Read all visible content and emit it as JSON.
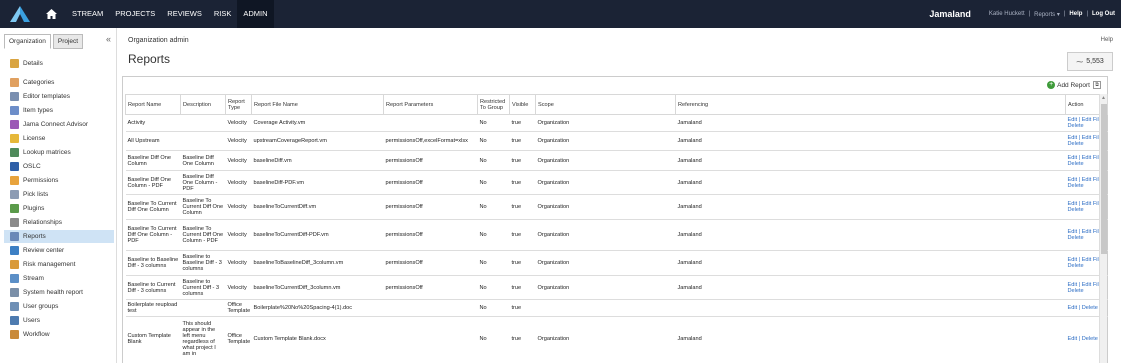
{
  "topnav": {
    "items": [
      "STREAM",
      "PROJECTS",
      "REVIEWS",
      "RISK",
      "ADMIN"
    ],
    "active": "ADMIN",
    "project": "Jamaland",
    "user": "Katie Huckett",
    "reports": "Reports ▾",
    "help": "Help",
    "logout": "Log Out",
    "separator": "|"
  },
  "sidebar": {
    "tabs": [
      "Organization",
      "Project"
    ],
    "collapse": "«",
    "items": [
      {
        "label": "Details",
        "icon": "details-icon",
        "color": "#d9a441"
      },
      {
        "label": "Categories",
        "icon": "categories-icon",
        "color": "#e0a060"
      },
      {
        "label": "Editor templates",
        "icon": "editor-templates-icon",
        "color": "#7a8fb0"
      },
      {
        "label": "Item types",
        "icon": "item-types-icon",
        "color": "#6d8ec9"
      },
      {
        "label": "Jama Connect Advisor",
        "icon": "advisor-icon",
        "color": "#9b59b6"
      },
      {
        "label": "License",
        "icon": "license-icon",
        "color": "#e6b83a"
      },
      {
        "label": "Lookup matrices",
        "icon": "lookup-matrices-icon",
        "color": "#4f8a5b"
      },
      {
        "label": "OSLC",
        "icon": "oslc-icon",
        "color": "#2e5fa8"
      },
      {
        "label": "Permissions",
        "icon": "permissions-icon",
        "color": "#e8a33c"
      },
      {
        "label": "Pick lists",
        "icon": "pick-lists-icon",
        "color": "#8c9bb3"
      },
      {
        "label": "Plugins",
        "icon": "plugins-icon",
        "color": "#5a9a4a"
      },
      {
        "label": "Relationships",
        "icon": "relationships-icon",
        "color": "#8a8a8a"
      },
      {
        "label": "Reports",
        "icon": "reports-icon",
        "color": "#6a88b8"
      },
      {
        "label": "Review center",
        "icon": "review-center-icon",
        "color": "#3c7fc4"
      },
      {
        "label": "Risk management",
        "icon": "risk-management-icon",
        "color": "#d99a3a"
      },
      {
        "label": "Stream",
        "icon": "stream-icon",
        "color": "#5b8fc7"
      },
      {
        "label": "System health report",
        "icon": "system-health-icon",
        "color": "#7a8fa8"
      },
      {
        "label": "User groups",
        "icon": "user-groups-icon",
        "color": "#6e8fb5"
      },
      {
        "label": "Users",
        "icon": "users-icon",
        "color": "#4d7bb0"
      },
      {
        "label": "Workflow",
        "icon": "workflow-icon",
        "color": "#c98a3a"
      }
    ],
    "active": "Reports"
  },
  "main": {
    "breadcrumb": "Organization admin",
    "help": "Help",
    "title": "Reports",
    "stat": "5,553",
    "add_report": "Add Report",
    "columns": [
      "Report Name",
      "Description",
      "Report Type",
      "Report File Name",
      "Report Parameters",
      "Restricted To Group",
      "Visible",
      "Scope",
      "Referencing",
      "Action"
    ],
    "rows": [
      {
        "name": "Activity",
        "desc": "",
        "type": "Velocity",
        "file": "Coverage Activity.vm",
        "params": "",
        "restricted": "No",
        "visible": "true",
        "scope": "Organization",
        "ref": "Jamaland",
        "action": "Edit | Edit File | Delete"
      },
      {
        "name": "All Upstream",
        "desc": "",
        "type": "Velocity",
        "file": "upstreamCoverageReport.vm",
        "params": "permissionsOff,excelFormat=xlsx",
        "restricted": "No",
        "visible": "true",
        "scope": "Organization",
        "ref": "Jamaland",
        "action": "Edit | Edit File | Delete"
      },
      {
        "name": "Baseline Diff One Column",
        "desc": "Baseline Diff One Column",
        "type": "Velocity",
        "file": "baselineDiff.vm",
        "params": "permissionsOff",
        "restricted": "No",
        "visible": "true",
        "scope": "Organization",
        "ref": "Jamaland",
        "action": "Edit | Edit File | Delete"
      },
      {
        "name": "Baseline Diff One Column - PDF",
        "desc": "Baseline Diff One Column - PDF",
        "type": "Velocity",
        "file": "baselineDiff-PDF.vm",
        "params": "permissionsOff",
        "restricted": "No",
        "visible": "true",
        "scope": "Organization",
        "ref": "Jamaland",
        "action": "Edit | Edit File | Delete"
      },
      {
        "name": "Baseline To Current Diff One Column",
        "desc": "Baseline To Current Diff One Column",
        "type": "Velocity",
        "file": "baselineToCurrentDiff.vm",
        "params": "permissionsOff",
        "restricted": "No",
        "visible": "true",
        "scope": "Organization",
        "ref": "Jamaland",
        "action": "Edit | Edit File | Delete"
      },
      {
        "name": "Baseline To Current Diff One Column - PDF",
        "desc": "Baseline To Current Diff One Column - PDF",
        "type": "Velocity",
        "file": "baselineToCurrentDiff-PDF.vm",
        "params": "permissionsOff",
        "restricted": "No",
        "visible": "true",
        "scope": "Organization",
        "ref": "Jamaland",
        "action": "Edit | Edit File | Delete"
      },
      {
        "name": "Baseline to Baseline Diff - 3 columns",
        "desc": "Baseline to Baseline Diff - 3 columns",
        "type": "Velocity",
        "file": "baselineToBaselineDiff_3column.vm",
        "params": "permissionsOff",
        "restricted": "No",
        "visible": "true",
        "scope": "Organization",
        "ref": "Jamaland",
        "action": "Edit | Edit File | Delete"
      },
      {
        "name": "Baseline to Current Diff - 3 columns",
        "desc": "Baseline to Current Diff - 3 columns",
        "type": "Velocity",
        "file": "baselineToCurrentDiff_3column.vm",
        "params": "permissionsOff",
        "restricted": "No",
        "visible": "true",
        "scope": "Organization",
        "ref": "Jamaland",
        "action": "Edit | Edit File | Delete"
      },
      {
        "name": "Boilerplate reupload test",
        "desc": "",
        "type": "Office Template",
        "file": "Boilerplate%20No%20Spacing-4(1).doc",
        "params": "",
        "restricted": "No",
        "visible": "true",
        "scope": "",
        "ref": "",
        "action": "Edit | Delete"
      },
      {
        "name": "Custom Template Blank",
        "desc": "This should appear in the left menu regardless of what project I am in",
        "type": "Office Template",
        "file": "Custom Template Blank.docx",
        "params": "",
        "restricted": "No",
        "visible": "true",
        "scope": "Organization",
        "ref": "Jamaland",
        "action": "Edit | Delete"
      }
    ]
  }
}
